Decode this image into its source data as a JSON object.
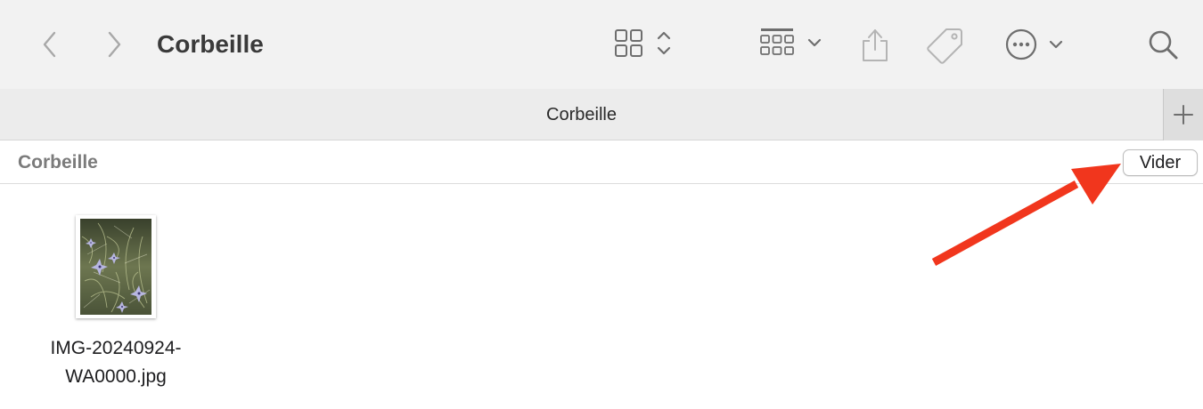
{
  "window": {
    "title": "Corbeille"
  },
  "toolbar": {
    "back_icon": "chevron-left-icon",
    "forward_icon": "chevron-right-icon",
    "view_icon": "grid-icon",
    "group_icon": "group-by-icon",
    "share_icon": "share-icon",
    "tag_icon": "tag-icon",
    "more_icon": "ellipsis-circle-icon",
    "search_icon": "search-icon"
  },
  "tabs": {
    "active_label": "Corbeille",
    "add_icon": "plus-icon"
  },
  "pathbar": {
    "label": "Corbeille",
    "empty_button_label": "Vider"
  },
  "files": [
    {
      "name_line1": "IMG-20240924-",
      "name_line2": "WA0000.jpg"
    }
  ],
  "annotation": {
    "arrow_color": "#f1361d"
  }
}
